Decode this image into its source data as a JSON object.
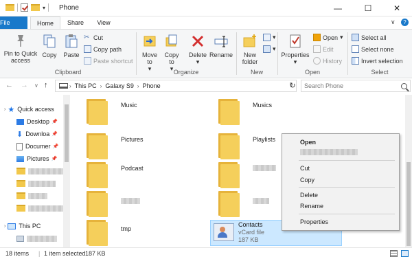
{
  "window": {
    "title": "Phone",
    "controls": {
      "minimize": "—",
      "maximize": "☐",
      "close": "✕"
    }
  },
  "ribbon_tabs": [
    "File",
    "Home",
    "Share",
    "View"
  ],
  "ribbon": {
    "clipboard": {
      "label": "Clipboard",
      "pin": "Pin to Quick access",
      "copy": "Copy",
      "paste": "Paste",
      "cut": "Cut",
      "copy_path": "Copy path",
      "paste_shortcut": "Paste shortcut"
    },
    "organize": {
      "label": "Organize",
      "move_to": "Move to",
      "copy_to": "Copy to",
      "delete": "Delete",
      "rename": "Rename"
    },
    "new": {
      "label": "New",
      "new_folder": "New folder"
    },
    "open": {
      "label": "Open",
      "properties": "Properties",
      "open": "Open",
      "edit": "Edit",
      "history": "History"
    },
    "select": {
      "label": "Select",
      "select_all": "Select all",
      "select_none": "Select none",
      "invert_selection": "Invert selection"
    }
  },
  "address": {
    "crumbs": [
      "This PC",
      "Galaxy S9",
      "Phone"
    ],
    "search_placeholder": "Search Phone"
  },
  "nav_pane": {
    "quick_access": "Quick access",
    "desktop": "Desktop",
    "downloads": "Downloa",
    "documents": "Documer",
    "pictures": "Pictures",
    "this_pc": "This PC"
  },
  "files": {
    "music": "Music",
    "musics": "Musics",
    "pictures": "Pictures",
    "playlists": "Playlists",
    "podcast": "Podcast",
    "tmp": "tmp",
    "contacts": {
      "name": "Contacts",
      "type": "vCard file",
      "size": "187 KB"
    }
  },
  "context_menu": {
    "open": "Open",
    "cut": "Cut",
    "copy": "Copy",
    "delete": "Delete",
    "rename": "Rename",
    "properties": "Properties"
  },
  "status": {
    "items": "18 items",
    "selected": "1 item selected",
    "size": "187 KB"
  },
  "colors": {
    "accent": "#1979ca",
    "folder": "#f5cf5b",
    "selection": "#cce8ff"
  }
}
